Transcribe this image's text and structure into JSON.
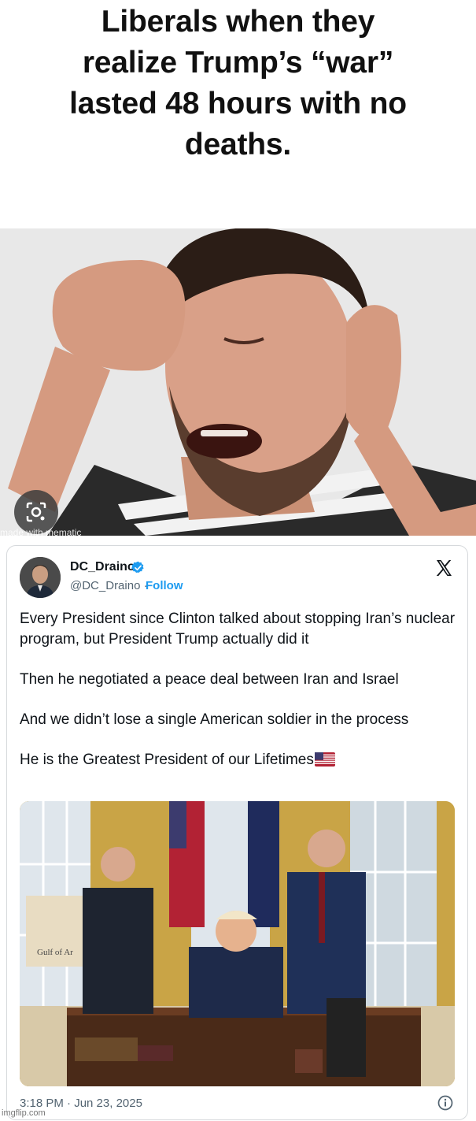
{
  "caption": {
    "line1": "Liberals when they",
    "line2": "realize Trump’s “war”",
    "line3": "lasted 48 hours with no",
    "line4": "deaths."
  },
  "photo": {
    "watermark": "made with mematic"
  },
  "tweet": {
    "display_name": "DC_Draino",
    "handle": "@DC_Draino",
    "separator": "·",
    "follow_label": "Follow",
    "paragraphs": [
      "Every President since Clinton talked about stopping Iran’s nuclear program, but President Trump actually did it",
      "Then he negotiated a peace deal between Iran and Israel",
      "And we didn’t lose a single American soldier in the process",
      "He is the Greatest President of our Lifetimes"
    ],
    "image_map_label": "Gulf of Ar",
    "timestamp": "3:18 PM · Jun 23, 2025",
    "verified_color": "#1d9bf0",
    "follow_color": "#1d9bf0"
  },
  "footer": {
    "watermark": "imgflip.com"
  },
  "icons": {
    "verified": "verified-badge-icon",
    "x_logo": "x-logo-icon",
    "info": "info-icon",
    "lens": "google-lens-icon",
    "flag": "us-flag-icon"
  }
}
